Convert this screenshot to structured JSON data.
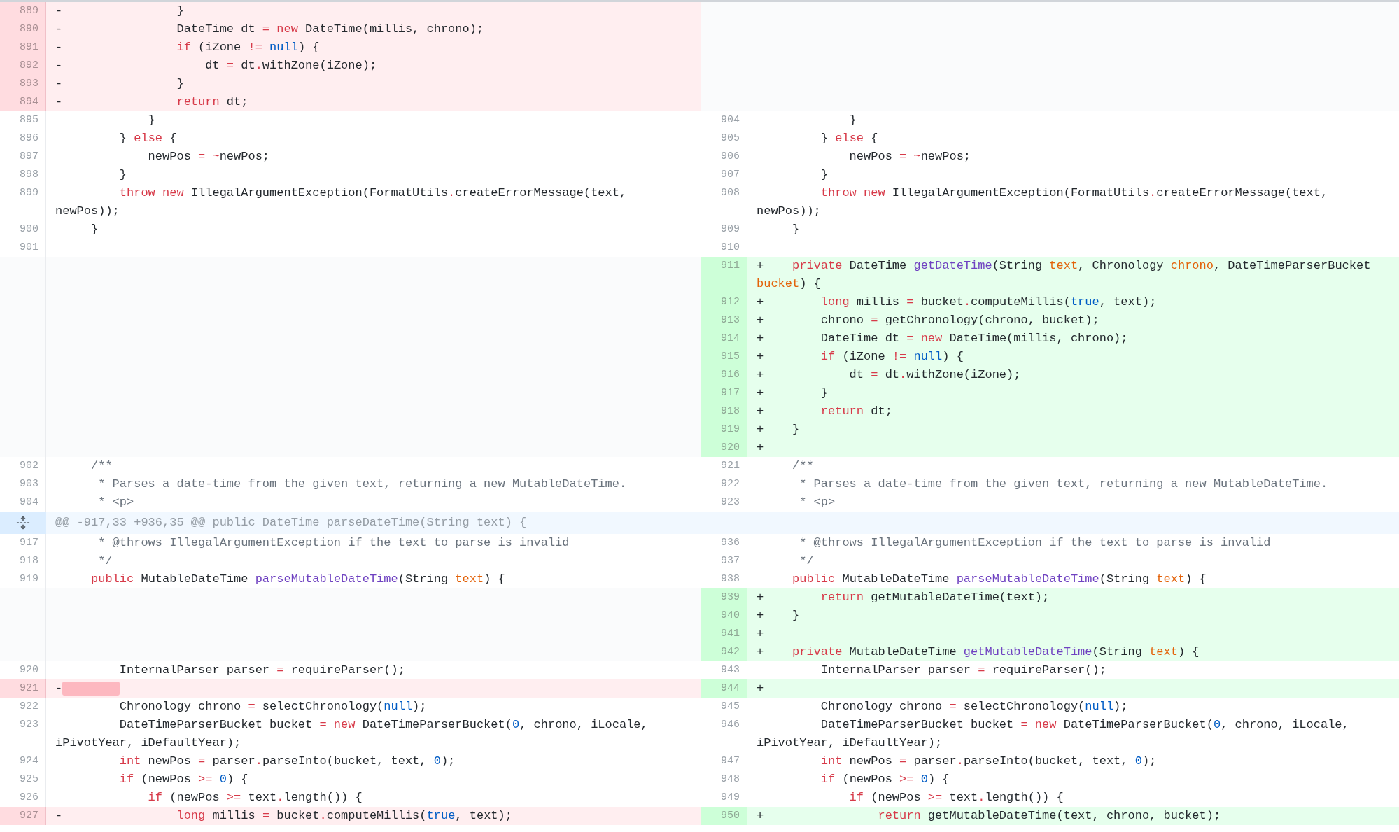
{
  "rows": [
    {
      "kind": "pair",
      "left": {
        "kind": "del",
        "number": "889",
        "sign": "-",
        "code": [
          {
            "text": "                }"
          }
        ]
      },
      "right": {
        "kind": "empty"
      }
    },
    {
      "kind": "pair",
      "left": {
        "kind": "del",
        "number": "890",
        "sign": "-",
        "code": [
          {
            "text": "                DateTime dt "
          },
          {
            "text": "= ",
            "kind": "keyword"
          },
          {
            "text": "new",
            "kind": "keyword"
          },
          {
            "text": " DateTime(millis, chrono);"
          }
        ]
      },
      "right": {
        "kind": "empty"
      }
    },
    {
      "kind": "pair",
      "left": {
        "kind": "del",
        "number": "891",
        "sign": "-",
        "code": [
          {
            "text": "                if",
            "kind": "keyword"
          },
          {
            "text": " (iZone "
          },
          {
            "text": "!= ",
            "kind": "keyword"
          },
          {
            "text": "null",
            "kind": "literal"
          },
          {
            "text": ") {"
          }
        ]
      },
      "right": {
        "kind": "empty"
      }
    },
    {
      "kind": "pair",
      "left": {
        "kind": "del",
        "number": "892",
        "sign": "-",
        "code": [
          {
            "text": "                    dt "
          },
          {
            "text": "=",
            "kind": "keyword"
          },
          {
            "text": " dt"
          },
          {
            "text": ".",
            "kind": "keyword"
          },
          {
            "text": "withZone(iZone);"
          }
        ]
      },
      "right": {
        "kind": "empty"
      }
    },
    {
      "kind": "pair",
      "left": {
        "kind": "del",
        "number": "893",
        "sign": "-",
        "code": [
          {
            "text": "                }"
          }
        ]
      },
      "right": {
        "kind": "empty"
      }
    },
    {
      "kind": "pair",
      "left": {
        "kind": "del",
        "number": "894",
        "sign": "-",
        "code": [
          {
            "text": "                return",
            "kind": "keyword"
          },
          {
            "text": " dt;"
          }
        ]
      },
      "right": {
        "kind": "empty"
      }
    },
    {
      "kind": "pair",
      "left": {
        "kind": "ctx",
        "number": "895",
        "code": [
          {
            "text": "            }"
          }
        ]
      },
      "right": {
        "kind": "ctx",
        "number": "904",
        "code": [
          {
            "text": "            }"
          }
        ]
      }
    },
    {
      "kind": "pair",
      "left": {
        "kind": "ctx",
        "number": "896",
        "code": [
          {
            "text": "        } "
          },
          {
            "text": "else",
            "kind": "keyword"
          },
          {
            "text": " {"
          }
        ]
      },
      "right": {
        "kind": "ctx",
        "number": "905",
        "code": [
          {
            "text": "        } "
          },
          {
            "text": "else",
            "kind": "keyword"
          },
          {
            "text": " {"
          }
        ]
      }
    },
    {
      "kind": "pair",
      "left": {
        "kind": "ctx",
        "number": "897",
        "code": [
          {
            "text": "            newPos "
          },
          {
            "text": "= ~",
            "kind": "keyword"
          },
          {
            "text": "newPos;"
          }
        ]
      },
      "right": {
        "kind": "ctx",
        "number": "906",
        "code": [
          {
            "text": "            newPos "
          },
          {
            "text": "= ~",
            "kind": "keyword"
          },
          {
            "text": "newPos;"
          }
        ]
      }
    },
    {
      "kind": "pair",
      "left": {
        "kind": "ctx",
        "number": "898",
        "code": [
          {
            "text": "        }"
          }
        ]
      },
      "right": {
        "kind": "ctx",
        "number": "907",
        "code": [
          {
            "text": "        }"
          }
        ]
      }
    },
    {
      "kind": "pair",
      "left": {
        "kind": "ctx",
        "number": "899",
        "code": [
          {
            "text": "        throw new",
            "kind": "keyword"
          },
          {
            "text": " IllegalArgumentException(FormatUtils"
          },
          {
            "text": ".",
            "kind": "keyword"
          },
          {
            "text": "createErrorMessage(text, newPos));"
          }
        ]
      },
      "right": {
        "kind": "ctx",
        "number": "908",
        "code": [
          {
            "text": "        throw new",
            "kind": "keyword"
          },
          {
            "text": " IllegalArgumentException(FormatUtils"
          },
          {
            "text": ".",
            "kind": "keyword"
          },
          {
            "text": "createErrorMessage(text, newPos));"
          }
        ]
      }
    },
    {
      "kind": "pair",
      "left": {
        "kind": "ctx",
        "number": "900",
        "code": [
          {
            "text": "    }"
          }
        ]
      },
      "right": {
        "kind": "ctx",
        "number": "909",
        "code": [
          {
            "text": "    }"
          }
        ]
      }
    },
    {
      "kind": "pair",
      "left": {
        "kind": "ctx",
        "number": "901"
      },
      "right": {
        "kind": "ctx",
        "number": "910"
      }
    },
    {
      "kind": "pair",
      "left": {
        "kind": "empty"
      },
      "right": {
        "kind": "add",
        "number": "911",
        "sign": "+",
        "code": [
          {
            "text": "    private",
            "kind": "keyword"
          },
          {
            "text": " DateTime "
          },
          {
            "text": "getDateTime",
            "kind": "function"
          },
          {
            "text": "(String "
          },
          {
            "text": "text",
            "kind": "param"
          },
          {
            "text": ", Chronology "
          },
          {
            "text": "chrono",
            "kind": "param"
          },
          {
            "text": ", DateTimeParserBucket "
          },
          {
            "text": "bucket",
            "kind": "param"
          },
          {
            "text": ") {"
          }
        ]
      }
    },
    {
      "kind": "pair",
      "left": {
        "kind": "empty"
      },
      "right": {
        "kind": "add",
        "number": "912",
        "sign": "+",
        "code": [
          {
            "text": "        long",
            "kind": "keyword"
          },
          {
            "text": " millis "
          },
          {
            "text": "=",
            "kind": "keyword"
          },
          {
            "text": " bucket"
          },
          {
            "text": ".",
            "kind": "keyword"
          },
          {
            "text": "computeMillis("
          },
          {
            "text": "true",
            "kind": "literal"
          },
          {
            "text": ", text);"
          }
        ]
      }
    },
    {
      "kind": "pair",
      "left": {
        "kind": "empty"
      },
      "right": {
        "kind": "add",
        "number": "913",
        "sign": "+",
        "code": [
          {
            "text": "        chrono "
          },
          {
            "text": "=",
            "kind": "keyword"
          },
          {
            "text": " getChronology(chrono, bucket);"
          }
        ]
      }
    },
    {
      "kind": "pair",
      "left": {
        "kind": "empty"
      },
      "right": {
        "kind": "add",
        "number": "914",
        "sign": "+",
        "code": [
          {
            "text": "        DateTime dt "
          },
          {
            "text": "= new",
            "kind": "keyword"
          },
          {
            "text": " DateTime(millis, chrono);"
          }
        ]
      }
    },
    {
      "kind": "pair",
      "left": {
        "kind": "empty"
      },
      "right": {
        "kind": "add",
        "number": "915",
        "sign": "+",
        "code": [
          {
            "text": "        if",
            "kind": "keyword"
          },
          {
            "text": " (iZone "
          },
          {
            "text": "!= ",
            "kind": "keyword"
          },
          {
            "text": "null",
            "kind": "literal"
          },
          {
            "text": ") {"
          }
        ]
      }
    },
    {
      "kind": "pair",
      "left": {
        "kind": "empty"
      },
      "right": {
        "kind": "add",
        "number": "916",
        "sign": "+",
        "code": [
          {
            "text": "            dt "
          },
          {
            "text": "=",
            "kind": "keyword"
          },
          {
            "text": " dt"
          },
          {
            "text": ".",
            "kind": "keyword"
          },
          {
            "text": "withZone(iZone);"
          }
        ]
      }
    },
    {
      "kind": "pair",
      "left": {
        "kind": "empty"
      },
      "right": {
        "kind": "add",
        "number": "917",
        "sign": "+",
        "code": [
          {
            "text": "        }"
          }
        ]
      }
    },
    {
      "kind": "pair",
      "left": {
        "kind": "empty"
      },
      "right": {
        "kind": "add",
        "number": "918",
        "sign": "+",
        "code": [
          {
            "text": "        return",
            "kind": "keyword"
          },
          {
            "text": " dt;"
          }
        ]
      }
    },
    {
      "kind": "pair",
      "left": {
        "kind": "empty"
      },
      "right": {
        "kind": "add",
        "number": "919",
        "sign": "+",
        "code": [
          {
            "text": "    }"
          }
        ]
      }
    },
    {
      "kind": "pair",
      "left": {
        "kind": "empty"
      },
      "right": {
        "kind": "add",
        "number": "920",
        "sign": "+"
      }
    },
    {
      "kind": "pair",
      "left": {
        "kind": "ctx",
        "number": "902",
        "code": [
          {
            "text": "    /**",
            "kind": "comment"
          }
        ]
      },
      "right": {
        "kind": "ctx",
        "number": "921",
        "code": [
          {
            "text": "    /**",
            "kind": "comment"
          }
        ]
      }
    },
    {
      "kind": "pair",
      "left": {
        "kind": "ctx",
        "number": "903",
        "code": [
          {
            "text": "     * Parses a date-time from the given text, returning a new MutableDateTime.",
            "kind": "comment"
          }
        ]
      },
      "right": {
        "kind": "ctx",
        "number": "922",
        "code": [
          {
            "text": "     * Parses a date-time from the given text, returning a new MutableDateTime.",
            "kind": "comment"
          }
        ]
      }
    },
    {
      "kind": "pair",
      "left": {
        "kind": "ctx",
        "number": "904",
        "code": [
          {
            "text": "     * <p>",
            "kind": "comment"
          }
        ]
      },
      "right": {
        "kind": "ctx",
        "number": "923",
        "code": [
          {
            "text": "     * <p>",
            "kind": "comment"
          }
        ]
      }
    },
    {
      "kind": "hunk",
      "text": "@@ -917,33 +936,35 @@ public DateTime parseDateTime(String text) {"
    },
    {
      "kind": "pair",
      "left": {
        "kind": "ctx",
        "number": "917",
        "code": [
          {
            "text": "     * @throws IllegalArgumentException if the text to parse is invalid",
            "kind": "comment"
          }
        ]
      },
      "right": {
        "kind": "ctx",
        "number": "936",
        "code": [
          {
            "text": "     * @throws IllegalArgumentException if the text to parse is invalid",
            "kind": "comment"
          }
        ]
      }
    },
    {
      "kind": "pair",
      "left": {
        "kind": "ctx",
        "number": "918",
        "code": [
          {
            "text": "     */",
            "kind": "comment"
          }
        ]
      },
      "right": {
        "kind": "ctx",
        "number": "937",
        "code": [
          {
            "text": "     */",
            "kind": "comment"
          }
        ]
      }
    },
    {
      "kind": "pair",
      "left": {
        "kind": "ctx",
        "number": "919",
        "code": [
          {
            "text": "    public",
            "kind": "keyword"
          },
          {
            "text": " MutableDateTime "
          },
          {
            "text": "parseMutableDateTime",
            "kind": "function"
          },
          {
            "text": "(String "
          },
          {
            "text": "text",
            "kind": "param"
          },
          {
            "text": ") {"
          }
        ]
      },
      "right": {
        "kind": "ctx",
        "number": "938",
        "code": [
          {
            "text": "    public",
            "kind": "keyword"
          },
          {
            "text": " MutableDateTime "
          },
          {
            "text": "parseMutableDateTime",
            "kind": "function"
          },
          {
            "text": "(String "
          },
          {
            "text": "text",
            "kind": "param"
          },
          {
            "text": ") {"
          }
        ]
      }
    },
    {
      "kind": "pair",
      "left": {
        "kind": "empty"
      },
      "right": {
        "kind": "add",
        "number": "939",
        "sign": "+",
        "code": [
          {
            "text": "        return",
            "kind": "keyword"
          },
          {
            "text": " getMutableDateTime(text);"
          }
        ]
      }
    },
    {
      "kind": "pair",
      "left": {
        "kind": "empty"
      },
      "right": {
        "kind": "add",
        "number": "940",
        "sign": "+",
        "code": [
          {
            "text": "    }"
          }
        ]
      }
    },
    {
      "kind": "pair",
      "left": {
        "kind": "empty"
      },
      "right": {
        "kind": "add",
        "number": "941",
        "sign": "+"
      }
    },
    {
      "kind": "pair",
      "left": {
        "kind": "empty"
      },
      "right": {
        "kind": "add",
        "number": "942",
        "sign": "+",
        "code": [
          {
            "text": "    private",
            "kind": "keyword"
          },
          {
            "text": " MutableDateTime "
          },
          {
            "text": "getMutableDateTime",
            "kind": "function"
          },
          {
            "text": "(String "
          },
          {
            "text": "text",
            "kind": "param"
          },
          {
            "text": ") {"
          }
        ]
      }
    },
    {
      "kind": "pair",
      "left": {
        "kind": "ctx",
        "number": "920",
        "code": [
          {
            "text": "        InternalParser parser "
          },
          {
            "text": "=",
            "kind": "keyword"
          },
          {
            "text": " requireParser();"
          }
        ]
      },
      "right": {
        "kind": "ctx",
        "number": "943",
        "code": [
          {
            "text": "        InternalParser parser "
          },
          {
            "text": "=",
            "kind": "keyword"
          },
          {
            "text": " requireParser();"
          }
        ]
      }
    },
    {
      "kind": "pair",
      "left": {
        "kind": "del",
        "number": "921",
        "sign": "-",
        "changed_whitespace": true
      },
      "right": {
        "kind": "add",
        "number": "944",
        "sign": "+"
      }
    },
    {
      "kind": "pair",
      "left": {
        "kind": "ctx",
        "number": "922",
        "code": [
          {
            "text": "        Chronology chrono "
          },
          {
            "text": "=",
            "kind": "keyword"
          },
          {
            "text": " selectChronology("
          },
          {
            "text": "null",
            "kind": "literal"
          },
          {
            "text": ");"
          }
        ]
      },
      "right": {
        "kind": "ctx",
        "number": "945",
        "code": [
          {
            "text": "        Chronology chrono "
          },
          {
            "text": "=",
            "kind": "keyword"
          },
          {
            "text": " selectChronology("
          },
          {
            "text": "null",
            "kind": "literal"
          },
          {
            "text": ");"
          }
        ]
      }
    },
    {
      "kind": "pair",
      "left": {
        "kind": "ctx",
        "number": "923",
        "code": [
          {
            "text": "        DateTimeParserBucket bucket "
          },
          {
            "text": "= new",
            "kind": "keyword"
          },
          {
            "text": " DateTimeParserBucket("
          },
          {
            "text": "0",
            "kind": "literal"
          },
          {
            "text": ", chrono, iLocale, iPivotYear, iDefaultYear);"
          }
        ]
      },
      "right": {
        "kind": "ctx",
        "number": "946",
        "code": [
          {
            "text": "        DateTimeParserBucket bucket "
          },
          {
            "text": "= new",
            "kind": "keyword"
          },
          {
            "text": " DateTimeParserBucket("
          },
          {
            "text": "0",
            "kind": "literal"
          },
          {
            "text": ", chrono, iLocale, iPivotYear, iDefaultYear);"
          }
        ]
      }
    },
    {
      "kind": "pair",
      "left": {
        "kind": "ctx",
        "number": "924",
        "code": [
          {
            "text": "        int",
            "kind": "keyword"
          },
          {
            "text": " newPos "
          },
          {
            "text": "=",
            "kind": "keyword"
          },
          {
            "text": " parser"
          },
          {
            "text": ".",
            "kind": "keyword"
          },
          {
            "text": "parseInto(bucket, text, "
          },
          {
            "text": "0",
            "kind": "literal"
          },
          {
            "text": ");"
          }
        ]
      },
      "right": {
        "kind": "ctx",
        "number": "947",
        "code": [
          {
            "text": "        int",
            "kind": "keyword"
          },
          {
            "text": " newPos "
          },
          {
            "text": "=",
            "kind": "keyword"
          },
          {
            "text": " parser"
          },
          {
            "text": ".",
            "kind": "keyword"
          },
          {
            "text": "parseInto(bucket, text, "
          },
          {
            "text": "0",
            "kind": "literal"
          },
          {
            "text": ");"
          }
        ]
      }
    },
    {
      "kind": "pair",
      "left": {
        "kind": "ctx",
        "number": "925",
        "code": [
          {
            "text": "        if",
            "kind": "keyword"
          },
          {
            "text": " (newPos "
          },
          {
            "text": ">= ",
            "kind": "keyword"
          },
          {
            "text": "0",
            "kind": "literal"
          },
          {
            "text": ") {"
          }
        ]
      },
      "right": {
        "kind": "ctx",
        "number": "948",
        "code": [
          {
            "text": "        if",
            "kind": "keyword"
          },
          {
            "text": " (newPos "
          },
          {
            "text": ">= ",
            "kind": "keyword"
          },
          {
            "text": "0",
            "kind": "literal"
          },
          {
            "text": ") {"
          }
        ]
      }
    },
    {
      "kind": "pair",
      "left": {
        "kind": "ctx",
        "number": "926",
        "code": [
          {
            "text": "            if",
            "kind": "keyword"
          },
          {
            "text": " (newPos "
          },
          {
            "text": ">=",
            "kind": "keyword"
          },
          {
            "text": " text"
          },
          {
            "text": ".",
            "kind": "keyword"
          },
          {
            "text": "length()) {"
          }
        ]
      },
      "right": {
        "kind": "ctx",
        "number": "949",
        "code": [
          {
            "text": "            if",
            "kind": "keyword"
          },
          {
            "text": " (newPos "
          },
          {
            "text": ">=",
            "kind": "keyword"
          },
          {
            "text": " text"
          },
          {
            "text": ".",
            "kind": "keyword"
          },
          {
            "text": "length()) {"
          }
        ]
      }
    },
    {
      "kind": "pair",
      "left": {
        "kind": "del",
        "number": "927",
        "sign": "-",
        "code": [
          {
            "text": "                long",
            "kind": "keyword"
          },
          {
            "text": " millis "
          },
          {
            "text": "=",
            "kind": "keyword"
          },
          {
            "text": " bucket"
          },
          {
            "text": ".",
            "kind": "keyword"
          },
          {
            "text": "computeMillis("
          },
          {
            "text": "true",
            "kind": "literal"
          },
          {
            "text": ", text);"
          }
        ]
      },
      "right": {
        "kind": "add",
        "number": "950",
        "sign": "+",
        "code": [
          {
            "text": "                return",
            "kind": "keyword"
          },
          {
            "text": " getMutableDateTime(text, chrono, bucket);"
          }
        ]
      }
    }
  ]
}
